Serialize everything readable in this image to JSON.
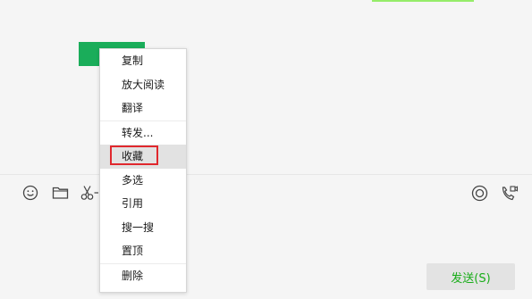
{
  "input": {
    "send_label": "发送(S)"
  },
  "toolbar": {
    "left_icons": [
      "emoji-icon",
      "folder-icon",
      "scissors-icon"
    ],
    "right_icons": [
      "live-icon",
      "video-call-icon"
    ]
  },
  "context_menu": {
    "groups": [
      [
        "复制",
        "放大阅读",
        "翻译"
      ],
      [
        "转发...",
        "收藏",
        "多选",
        "引用",
        "搜一搜",
        "置顶"
      ],
      [
        "删除"
      ]
    ],
    "highlighted_item": "收藏"
  },
  "colors": {
    "background": "#f5f5f5",
    "bubble_green": "#1aad5a",
    "send_text": "#19ad19",
    "highlight_border": "#e0282d"
  }
}
